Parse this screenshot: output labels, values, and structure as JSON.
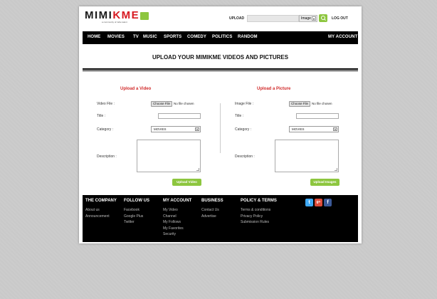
{
  "logo": {
    "text_part1": "MIMI",
    "text_part2": "KME",
    "tagline": "a community of indie talent"
  },
  "header": {
    "upload": "UPLOAD",
    "search_select": "Image",
    "logout": "LOG OUT"
  },
  "nav": {
    "items": [
      "HOME",
      "MOVIES",
      "TV",
      "MUSIC",
      "SPORTS",
      "COMEDY",
      "POLITICS",
      "RANDOM"
    ],
    "account": "MY ACCOUNT"
  },
  "page_title": "UPLOAD YOUR MIMIKME VIDEOS AND PICTURES",
  "video_form": {
    "title": "Upload a Video",
    "file_label": "Video File :",
    "file_button": "Choose File",
    "file_status": "No file chosen",
    "title_label": "Title :",
    "category_label": "Category :",
    "category_value": "MOVIES",
    "description_label": "Description :",
    "submit": "Upload Video"
  },
  "image_form": {
    "title": "Upload a Picture",
    "file_label": "Image File :",
    "file_button": "Choose File",
    "file_status": "No file chosen",
    "title_label": "Title :",
    "category_label": "Category :",
    "category_value": "MOVIES",
    "description_label": "Description :",
    "submit": "Upload Images"
  },
  "footer": {
    "columns": [
      {
        "heading": "THE COMPANY",
        "items": [
          "About us",
          "Announcement"
        ]
      },
      {
        "heading": "FOLLOW US",
        "items": [
          "Facebook",
          "Google Plus",
          "Twitter"
        ]
      },
      {
        "heading": "MY ACCOUNT",
        "items": [
          "My Video",
          "Channel",
          "My Follows",
          "My Favorites",
          "Security"
        ]
      },
      {
        "heading": "BUSINESS",
        "items": [
          "Contact Us",
          "Advertise"
        ]
      },
      {
        "heading": "POLICY & TERMS",
        "items": [
          "Terms & conditions",
          "Privacy Policy",
          "Submission Rules"
        ]
      }
    ],
    "social_icons": [
      "twitter-icon",
      "google-plus-icon",
      "facebook-icon"
    ],
    "social_glyphs": [
      "t",
      "g+",
      "f"
    ]
  },
  "colors": {
    "accent_green": "#8dc63f",
    "accent_red": "#d12b2b",
    "nav_bg": "#000000",
    "twitter": "#3fa9f5",
    "google": "#dd4b39",
    "facebook": "#3b5998"
  }
}
